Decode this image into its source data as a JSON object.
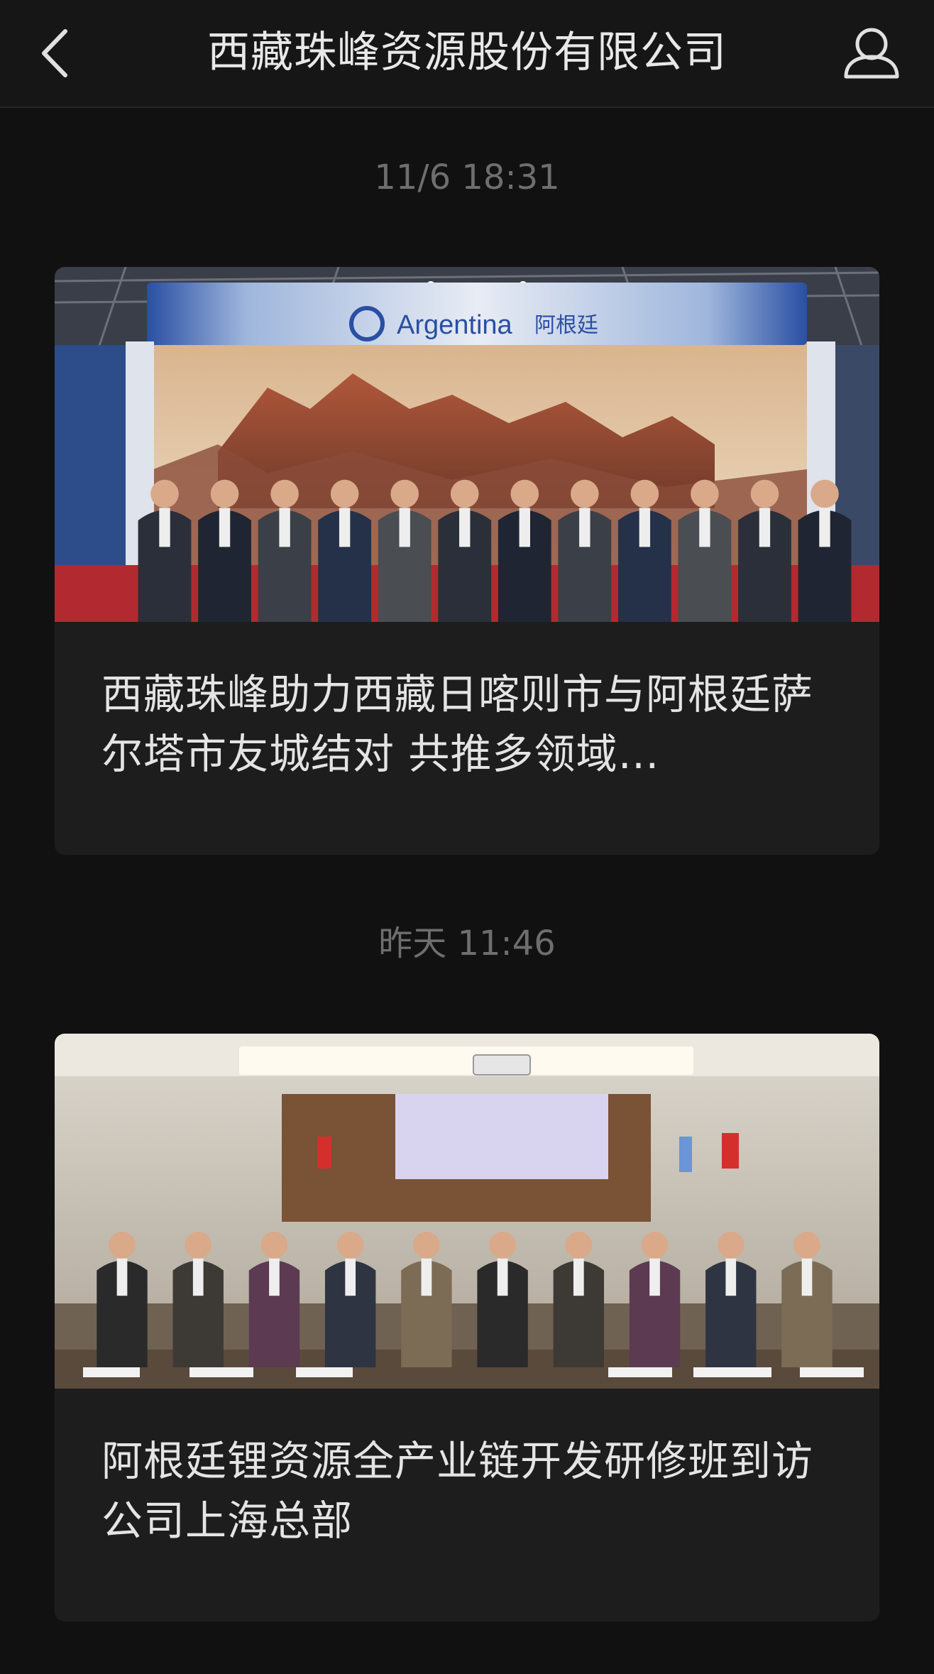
{
  "header": {
    "title": "西藏珠峰资源股份有限公司",
    "back_icon": "chevron-left-icon",
    "profile_icon": "user-icon"
  },
  "feed": [
    {
      "timestamp": "11/6 18:31",
      "image_sign_text": "Argentina",
      "image_sign_text_cn": "阿根廷",
      "title": "西藏珠峰助力西藏日喀则市与阿根廷萨尔塔市友城结对  共推多领域…"
    },
    {
      "timestamp": "昨天 11:46",
      "title": "阿根廷锂资源全产业链开发研修班到访公司上海总部"
    }
  ],
  "colors": {
    "background": "#111111",
    "header_bg": "#161616",
    "card_bg": "#1d1d1d",
    "timestamp": "#6e6e6e",
    "title_text": "#e4e4e4"
  }
}
